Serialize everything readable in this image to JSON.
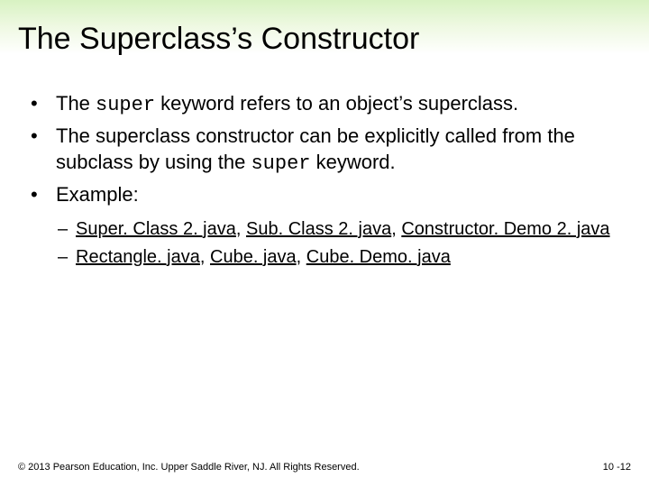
{
  "title": "The Superclass’s Constructor",
  "bullets": {
    "b1_pre": "The ",
    "b1_code": "super",
    "b1_post": " keyword refers to an object’s superclass.",
    "b2_pre": "The superclass constructor can be explicitly called from the subclass by using the ",
    "b2_code": "super",
    "b2_post": " keyword.",
    "b3": "Example:"
  },
  "sublinks": {
    "row1": {
      "a": "Super. Class 2. java",
      "b": "Sub. Class 2. java",
      "c": "Constructor. Demo 2. java"
    },
    "row2": {
      "a": "Rectangle. java",
      "b": "Cube. java",
      "c": "Cube. Demo. java"
    }
  },
  "sep": ", ",
  "dash": "– ",
  "dot": "•",
  "footer": {
    "copyright": "© 2013 Pearson Education, Inc. Upper Saddle River, NJ. All Rights Reserved.",
    "pagenum": "10 -12"
  }
}
